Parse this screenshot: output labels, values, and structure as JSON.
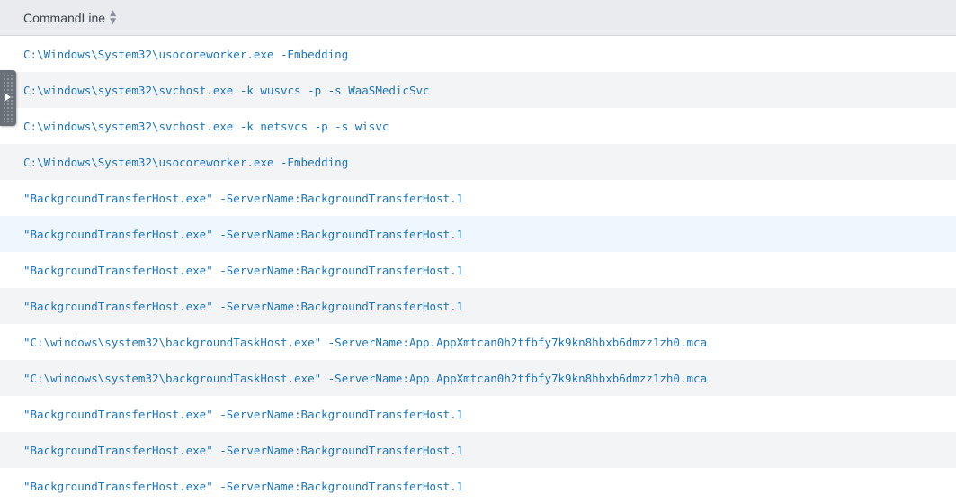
{
  "table": {
    "column_header": "CommandLine",
    "sort_icon": "sort-icon",
    "rows": [
      "C:\\Windows\\System32\\usocoreworker.exe -Embedding",
      "C:\\windows\\system32\\svchost.exe -k wusvcs -p -s WaaSMedicSvc",
      "C:\\windows\\system32\\svchost.exe -k netsvcs -p -s wisvc",
      "C:\\Windows\\System32\\usocoreworker.exe -Embedding",
      "\"BackgroundTransferHost.exe\" -ServerName:BackgroundTransferHost.1",
      "\"BackgroundTransferHost.exe\" -ServerName:BackgroundTransferHost.1",
      "\"BackgroundTransferHost.exe\" -ServerName:BackgroundTransferHost.1",
      "\"BackgroundTransferHost.exe\" -ServerName:BackgroundTransferHost.1",
      "\"C:\\windows\\system32\\backgroundTaskHost.exe\" -ServerName:App.AppXmtcan0h2tfbfy7k9kn8hbxb6dmzz1zh0.mca",
      "\"C:\\windows\\system32\\backgroundTaskHost.exe\" -ServerName:App.AppXmtcan0h2tfbfy7k9kn8hbxb6dmzz1zh0.mca",
      "\"BackgroundTransferHost.exe\" -ServerName:BackgroundTransferHost.1",
      "\"BackgroundTransferHost.exe\" -ServerName:BackgroundTransferHost.1",
      "\"BackgroundTransferHost.exe\" -ServerName:BackgroundTransferHost.1"
    ]
  },
  "drawer_handle": {
    "icon": "play-icon"
  },
  "colors": {
    "link": "#1b75bb",
    "header_bg": "#e9ebee",
    "row_stripe": "#f3f4f6",
    "row_hover": "#eef7fd",
    "handle": "#6a7077"
  }
}
